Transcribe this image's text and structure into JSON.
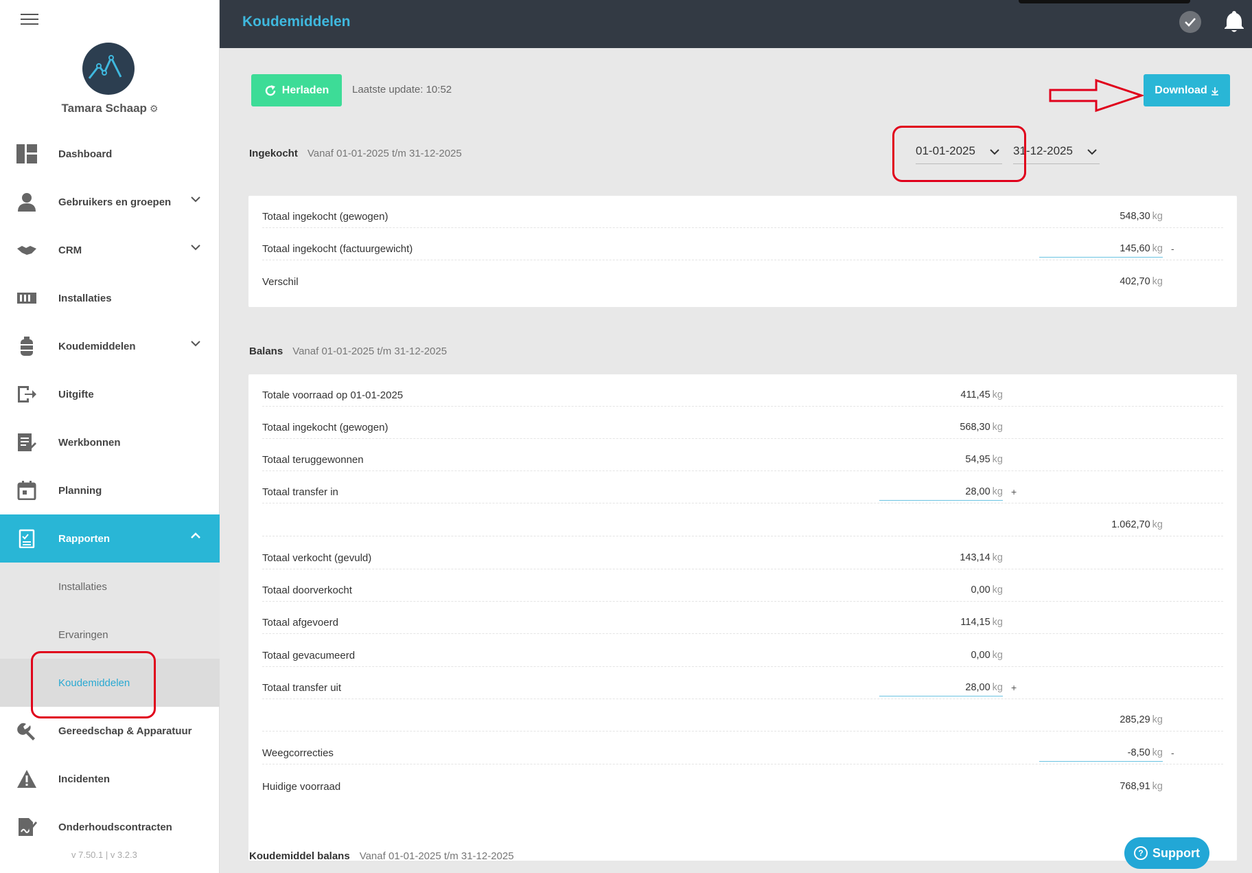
{
  "app": {
    "title": "Koudemiddelen",
    "version": "v 7.50.1  | v 3.2.3"
  },
  "user": {
    "name": "Tamara Schaap"
  },
  "sidebar": {
    "items": [
      {
        "label": "Dashboard",
        "icon": "dashboard-icon"
      },
      {
        "label": "Gebruikers en groepen",
        "icon": "user-icon"
      },
      {
        "label": "CRM",
        "icon": "handshake-icon"
      },
      {
        "label": "Installaties",
        "icon": "installation-icon"
      },
      {
        "label": "Koudemiddelen",
        "icon": "cylinder-icon"
      },
      {
        "label": "Uitgifte",
        "icon": "export-icon"
      },
      {
        "label": "Werkbonnen",
        "icon": "document-edit-icon"
      },
      {
        "label": "Planning",
        "icon": "calendar-icon"
      },
      {
        "label": "Rapporten",
        "icon": "report-icon"
      },
      {
        "label": "Gereedschap & Apparatuur",
        "icon": "wrench-icon"
      },
      {
        "label": "Incidenten",
        "icon": "warning-icon"
      },
      {
        "label": "Onderhoudscontracten",
        "icon": "contract-icon"
      }
    ],
    "sub_items": [
      {
        "label": "Installaties"
      },
      {
        "label": "Ervaringen"
      },
      {
        "label": "Koudemiddelen"
      }
    ]
  },
  "toolbar": {
    "reload_label": "Herladen",
    "last_update": "Laatste update: 10:52",
    "download_label": "Download"
  },
  "filters": {
    "date_from": "01-01-2025",
    "date_to": "31-12-2025"
  },
  "sections": {
    "ingekocht": {
      "title": "Ingekocht",
      "range": "Vanaf 01-01-2025 t/m 31-12-2025",
      "rows": [
        {
          "label": "Totaal ingekocht (gewogen)",
          "value": "548,30",
          "unit": "kg"
        },
        {
          "label": "Totaal ingekocht (factuurgewicht)",
          "value": "145,60",
          "unit": "kg",
          "op": "-"
        },
        {
          "label": "Verschil",
          "value": "402,70",
          "unit": "kg"
        }
      ]
    },
    "balans": {
      "title": "Balans",
      "range": "Vanaf 01-01-2025 t/m 31-12-2025",
      "rows": [
        {
          "label": "Totale voorraad op 01-01-2025",
          "value": "411,45",
          "unit": "kg"
        },
        {
          "label": "Totaal ingekocht (gewogen)",
          "value": "568,30",
          "unit": "kg"
        },
        {
          "label": "Totaal teruggewonnen",
          "value": "54,95",
          "unit": "kg"
        },
        {
          "label": "Totaal transfer in",
          "value": "28,00",
          "unit": "kg",
          "op": "+"
        },
        {
          "label": "",
          "value": "1.062,70",
          "unit": "kg"
        },
        {
          "label": "Totaal verkocht (gevuld)",
          "value": "143,14",
          "unit": "kg"
        },
        {
          "label": "Totaal doorverkocht",
          "value": "0,00",
          "unit": "kg"
        },
        {
          "label": "Totaal afgevoerd",
          "value": "114,15",
          "unit": "kg"
        },
        {
          "label": "Totaal gevacumeerd",
          "value": "0,00",
          "unit": "kg"
        },
        {
          "label": "Totaal transfer uit",
          "value": "28,00",
          "unit": "kg",
          "op": "+"
        },
        {
          "label": "",
          "value": "285,29",
          "unit": "kg"
        },
        {
          "label": "Weegcorrecties",
          "value": "-8,50",
          "unit": "kg",
          "op": "-"
        },
        {
          "label": "Huidige voorraad",
          "value": "768,91",
          "unit": "kg"
        }
      ]
    },
    "koudemiddel_balans": {
      "title": "Koudemiddel balans",
      "range": "Vanaf 01-01-2025 t/m 31-12-2025"
    }
  },
  "support": {
    "label": "Support"
  },
  "colors": {
    "accent": "#29b6d6",
    "reload": "#3ddc97",
    "topbar": "#333a44",
    "annotation": "#e0001b"
  }
}
